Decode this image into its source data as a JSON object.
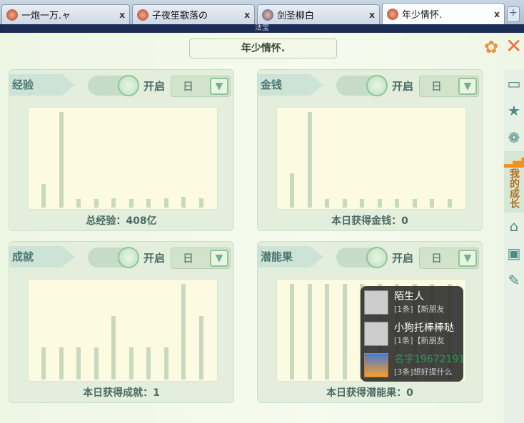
{
  "tabs": [
    {
      "label": "一炮一万.ャ"
    },
    {
      "label": "子夜笙歌落の"
    },
    {
      "label": "剑圣柳白"
    },
    {
      "label": "年少情怀.",
      "active": true
    }
  ],
  "tab_close": "x",
  "new_tab": "+",
  "strip_text": "法宝",
  "window": {
    "title": "年少情怀.",
    "settings_icon": "gear-icon",
    "close_icon": "close-icon"
  },
  "panels": [
    {
      "label": "经验",
      "toggle": "开启",
      "toggle_on": true,
      "period": "日",
      "footer": "总经验：408亿",
      "chart_data": {
        "type": "bar",
        "values": [
          25,
          100,
          9,
          9,
          10,
          9,
          9,
          10,
          11,
          10
        ]
      }
    },
    {
      "label": "金钱",
      "toggle": "开启",
      "toggle_on": true,
      "period": "日",
      "footer": "本日获得金钱：0",
      "chart_data": {
        "type": "bar",
        "values": [
          36,
          100,
          9,
          9,
          9,
          9,
          9,
          9,
          9,
          9
        ]
      }
    },
    {
      "label": "成就",
      "toggle": "开启",
      "toggle_on": true,
      "period": "日",
      "footer": "本日获得成就：1",
      "chart_data": {
        "type": "bar",
        "values": [
          1,
          1,
          1,
          1,
          2,
          1,
          1,
          1,
          3,
          2
        ]
      }
    },
    {
      "label": "潜能果",
      "toggle": "开启",
      "toggle_on": true,
      "period": "日",
      "footer": "本日获得潜能果：0",
      "chart_data": {
        "type": "bar",
        "values": [
          2,
          2,
          2,
          2,
          2,
          2,
          2,
          2,
          2,
          2
        ]
      }
    }
  ],
  "sidebar": {
    "items": [
      {
        "icon": "chat-icon"
      },
      {
        "icon": "star-icon"
      },
      {
        "icon": "paw-icon"
      },
      {
        "icon": "signal-icon",
        "label": "我的成长",
        "active": true
      },
      {
        "icon": "home-icon"
      },
      {
        "icon": "box-icon"
      },
      {
        "icon": "palette-icon"
      }
    ]
  },
  "chat_popup": [
    {
      "name": "陌生人",
      "msg": "[1条]【新朋友"
    },
    {
      "name": "小狗托棒棒哒",
      "msg": "[1条]【新朋友"
    },
    {
      "name": "名字19672191",
      "msg": "[3条]想好提什么",
      "name_color": "#1fa05a"
    }
  ]
}
